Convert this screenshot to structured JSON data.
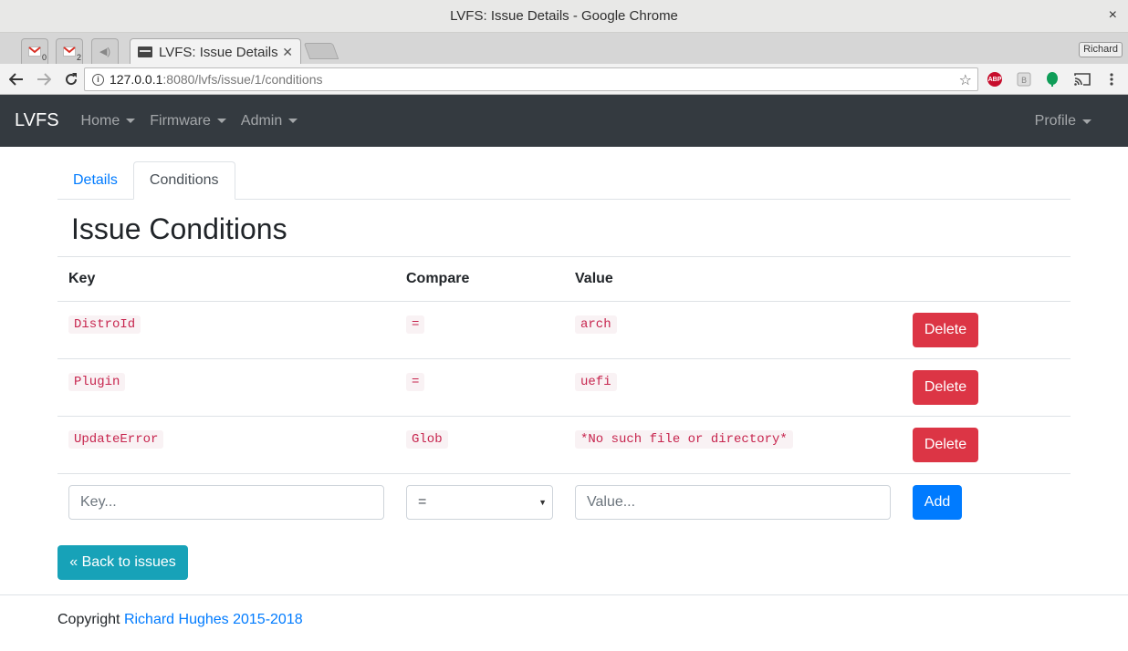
{
  "window": {
    "title": "LVFS: Issue Details - Google Chrome",
    "close_icon": "×"
  },
  "browser": {
    "pinned_tabs": [
      {
        "icon": "gmail-icon",
        "count": "0"
      },
      {
        "icon": "gmail-icon",
        "count": "2"
      },
      {
        "icon": "speaker-icon"
      }
    ],
    "active_tab": {
      "title": "LVFS: Issue Details"
    },
    "profile": "Richard",
    "url": {
      "host": "127.0.0.1",
      "path": ":8080/lvfs/issue/1/conditions"
    },
    "extensions": [
      "abp-icon",
      "extension-icon",
      "leaf-icon",
      "cast-icon",
      "menu-icon"
    ]
  },
  "navbar": {
    "brand": "LVFS",
    "items": [
      {
        "label": "Home"
      },
      {
        "label": "Firmware"
      },
      {
        "label": "Admin"
      }
    ],
    "right": {
      "label": "Profile"
    }
  },
  "tabs": [
    {
      "label": "Details",
      "active": false
    },
    {
      "label": "Conditions",
      "active": true
    }
  ],
  "page": {
    "title": "Issue Conditions",
    "headers": [
      "Key",
      "Compare",
      "Value",
      ""
    ],
    "rows": [
      {
        "key": "DistroId",
        "compare": "=",
        "value": "arch",
        "action": "Delete"
      },
      {
        "key": "Plugin",
        "compare": "=",
        "value": "uefi",
        "action": "Delete"
      },
      {
        "key": "UpdateError",
        "compare": "Glob",
        "value": "*No such file or directory*",
        "action": "Delete"
      }
    ],
    "form": {
      "key_placeholder": "Key...",
      "compare_selected": "=",
      "value_placeholder": "Value...",
      "add_label": "Add"
    },
    "back_label": "« Back to issues"
  },
  "footer": {
    "prefix": "Copyright",
    "link": "Richard Hughes 2015-2018"
  },
  "colors": {
    "navbar": "#343a40",
    "danger": "#dc3545",
    "primary": "#007bff",
    "info": "#17a2b8"
  }
}
